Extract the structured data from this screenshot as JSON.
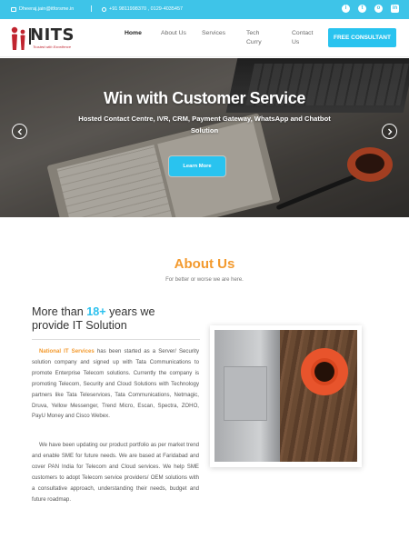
{
  "topbar": {
    "email": "Dheeraj.jain@itforsme.in",
    "phone": "+91 9811998370 ,  0129-4035457",
    "socials": [
      "info-icon",
      "twitter-icon",
      "instagram-icon",
      "linkedin-icon"
    ]
  },
  "header": {
    "logo_text": "NITS",
    "logo_tagline": "Trusted with Excellence",
    "nav": [
      {
        "label": "Home"
      },
      {
        "label": "About Us"
      },
      {
        "label": "Services"
      },
      {
        "label": "Tech Curry"
      },
      {
        "label": "Contact Us"
      }
    ],
    "cta_label": "FREE CONSULTANT"
  },
  "hero": {
    "title": "Win with Customer Service",
    "subtitle": "Hosted Contact Centre, IVR, CRM, Payment Gateway, WhatsApp and Chatbot Solution",
    "button_label": "Learn More"
  },
  "about": {
    "title": "About Us",
    "subtitle": "For better or worse we are here.",
    "heading_pre": "More than ",
    "heading_highlight": "18+",
    "heading_post": " years we provide IT Solution",
    "p1_brand": "National IT Services",
    "p1_rest": " has been started as a Server/ Security solution company and signed up with Tata Communications to promote Enterprise Telecom solutions. Currently the company is promoting Telecom, Security and Cloud Solutions with Technology partners like Tata Teleservices, Tata Communications, Netmagic, Druva, Yellow Messenger, Trend Micro, Escan, Spectra, ZOHO, PayU Money and Cisco Webex.",
    "p2": "We have been updating our product portfolio as per market trend and enable SME for future needs. We are based at Faridabad and cover PAN India for Telecom and Cloud services. We help SME customers to adopt Telecom service providers/ OEM solutions with a consultative approach, understanding their needs, budget and future roadmap."
  },
  "colors": {
    "accent_blue": "#29c3ef",
    "accent_orange": "#f39a2e",
    "topbar": "#3ec4e8"
  }
}
